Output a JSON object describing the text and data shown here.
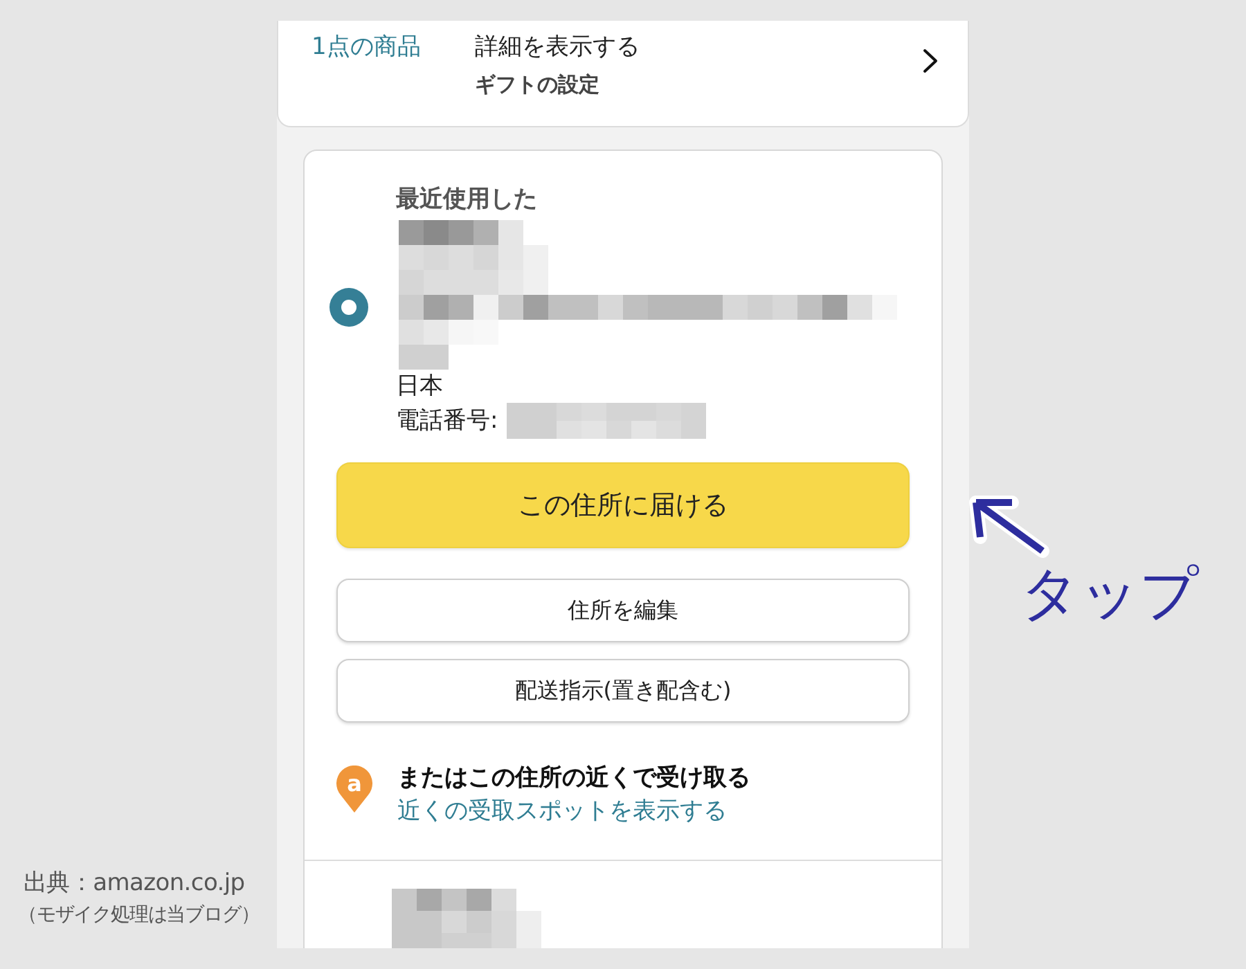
{
  "order_summary": {
    "item_count": "1点の商品",
    "details_link": "詳細を表示する",
    "gift_settings": "ギフトの設定"
  },
  "address_card": {
    "selected": true,
    "heading": "最近使用した",
    "country": "日本",
    "phone_label": "電話番号:",
    "primary_button": "この住所に届ける",
    "buttons": [
      "住所を編集",
      "配送指示(置き配含む)"
    ],
    "pickup": {
      "icon_letter": "a",
      "title": "またはこの住所の近くで受け取る",
      "link": "近くの受取スポットを表示する"
    }
  },
  "annotation": {
    "label": "タップ"
  },
  "credit": {
    "source": "出典：amazon.co.jp",
    "note": "（モザイク処理は当ブログ）"
  }
}
